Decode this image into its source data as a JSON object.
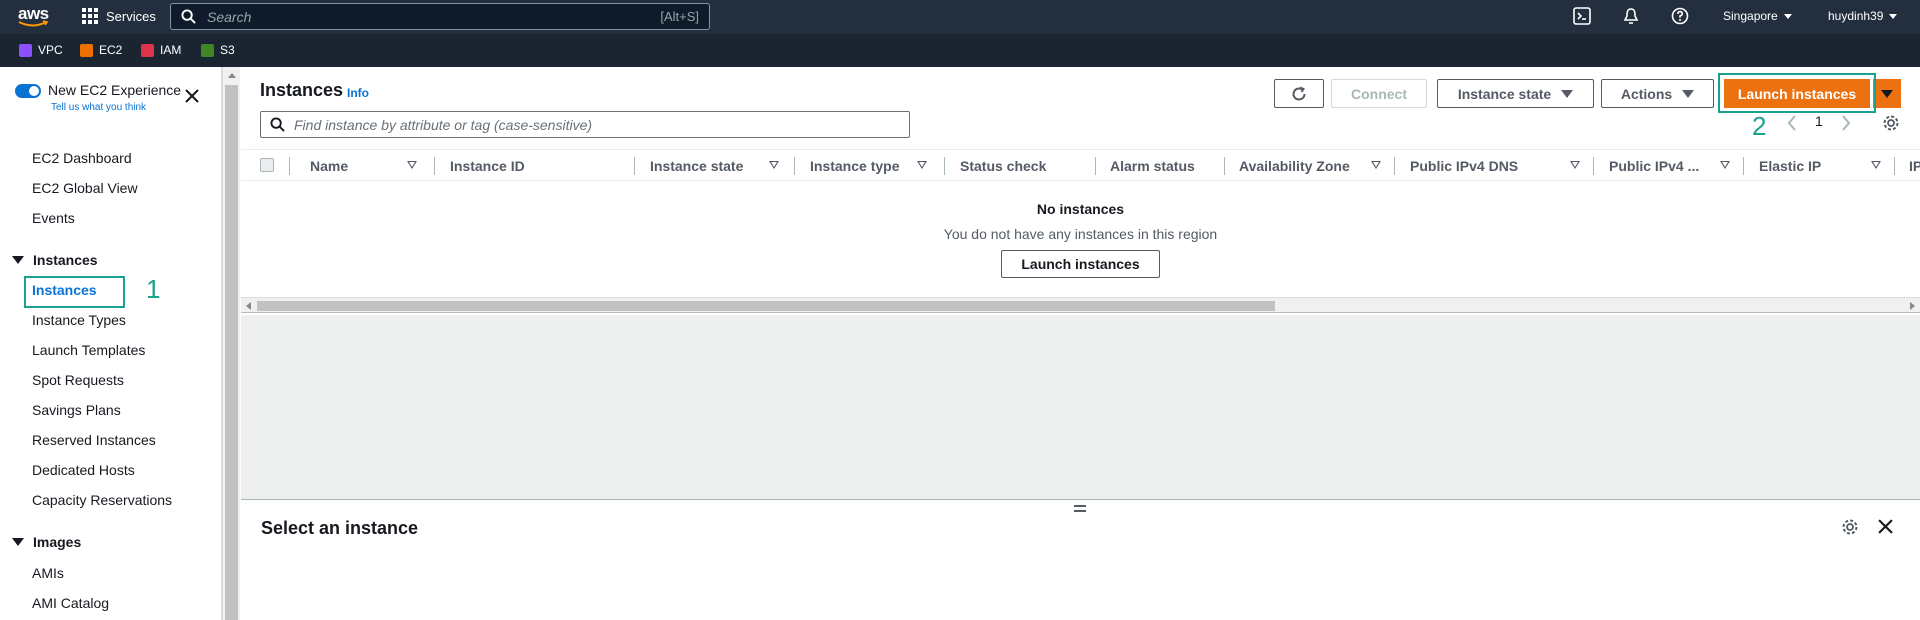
{
  "topnav": {
    "logo_text": "aws",
    "services_label": "Services",
    "search_placeholder": "Search",
    "search_shortcut": "[Alt+S]",
    "region": "Singapore",
    "user": "huydinh39"
  },
  "favorites": [
    {
      "label": "VPC",
      "color": "#8c4fff"
    },
    {
      "label": "EC2",
      "color": "#ed7100"
    },
    {
      "label": "IAM",
      "color": "#dd344c"
    },
    {
      "label": "S3",
      "color": "#3f8624"
    }
  ],
  "sidebar": {
    "new_experience": "New EC2 Experience",
    "tell_us": "Tell us what you think",
    "top_links": [
      "EC2 Dashboard",
      "EC2 Global View",
      "Events"
    ],
    "section_instances": "Instances",
    "instances_items": [
      "Instances",
      "Instance Types",
      "Launch Templates",
      "Spot Requests",
      "Savings Plans",
      "Reserved Instances",
      "Dedicated Hosts",
      "Capacity Reservations"
    ],
    "section_images": "Images",
    "images_items": [
      "AMIs",
      "AMI Catalog"
    ],
    "annotation": "1"
  },
  "main": {
    "title": "Instances",
    "info": "Info",
    "connect": "Connect",
    "instance_state": "Instance state",
    "actions": "Actions",
    "launch": "Launch instances",
    "annotation": "2",
    "find_placeholder": "Find instance by attribute or tag (case-sensitive)",
    "page": "1",
    "columns": [
      "Name",
      "Instance ID",
      "Instance state",
      "Instance type",
      "Status check",
      "Alarm status",
      "Availability Zone",
      "Public IPv4 DNS",
      "Public IPv4 ...",
      "Elastic IP",
      "IP"
    ],
    "empty_title": "No instances",
    "empty_sub": "You do not have any instances in this region",
    "empty_button": "Launch instances"
  },
  "split_panel": {
    "title": "Select an instance"
  },
  "colors": {
    "nav_bg": "#232f3e",
    "accent": "#0972d3",
    "primary": "#ec7211",
    "annotation": "#1aa38c"
  }
}
